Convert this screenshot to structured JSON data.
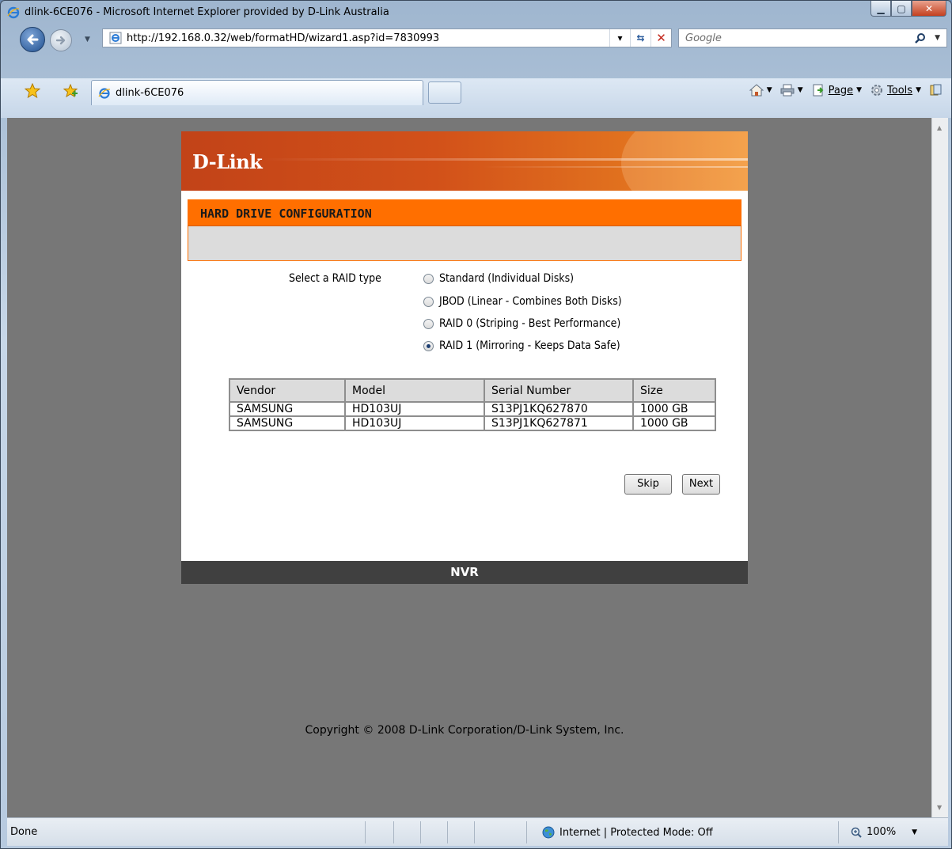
{
  "window": {
    "title": "dlink-6CE076 - Microsoft Internet Explorer provided by D-Link Australia"
  },
  "navbar": {
    "url": "http://192.168.0.32/web/formatHD/wizard1.asp?id=7830993",
    "search_placeholder": "Google"
  },
  "tabbar": {
    "tab_title": "dlink-6CE076",
    "page_label": "Page",
    "tools_label": "Tools"
  },
  "page": {
    "brand": "D-Link",
    "section_title": "HARD DRIVE CONFIGURATION",
    "raid_label": "Select a RAID type",
    "raid_options": [
      {
        "label": "Standard (Individual Disks)",
        "selected": false
      },
      {
        "label": "JBOD (Linear - Combines Both Disks)",
        "selected": false
      },
      {
        "label": "RAID 0 (Striping - Best Performance)",
        "selected": false
      },
      {
        "label": "RAID 1 (Mirroring - Keeps Data Safe)",
        "selected": true
      }
    ],
    "table": {
      "headers": [
        "Vendor",
        "Model",
        "Serial Number",
        "Size"
      ],
      "rows": [
        [
          "SAMSUNG",
          "HD103UJ",
          "S13PJ1KQ627870",
          "1000 GB"
        ],
        [
          "SAMSUNG",
          "HD103UJ",
          "S13PJ1KQ627871",
          "1000 GB"
        ]
      ]
    },
    "skip_label": "Skip",
    "next_label": "Next",
    "footer": "NVR",
    "copyright": "Copyright © 2008 D-Link Corporation/D-Link System, Inc."
  },
  "statusbar": {
    "status": "Done",
    "zone": "Internet | Protected Mode: Off",
    "zoom": "100%"
  }
}
